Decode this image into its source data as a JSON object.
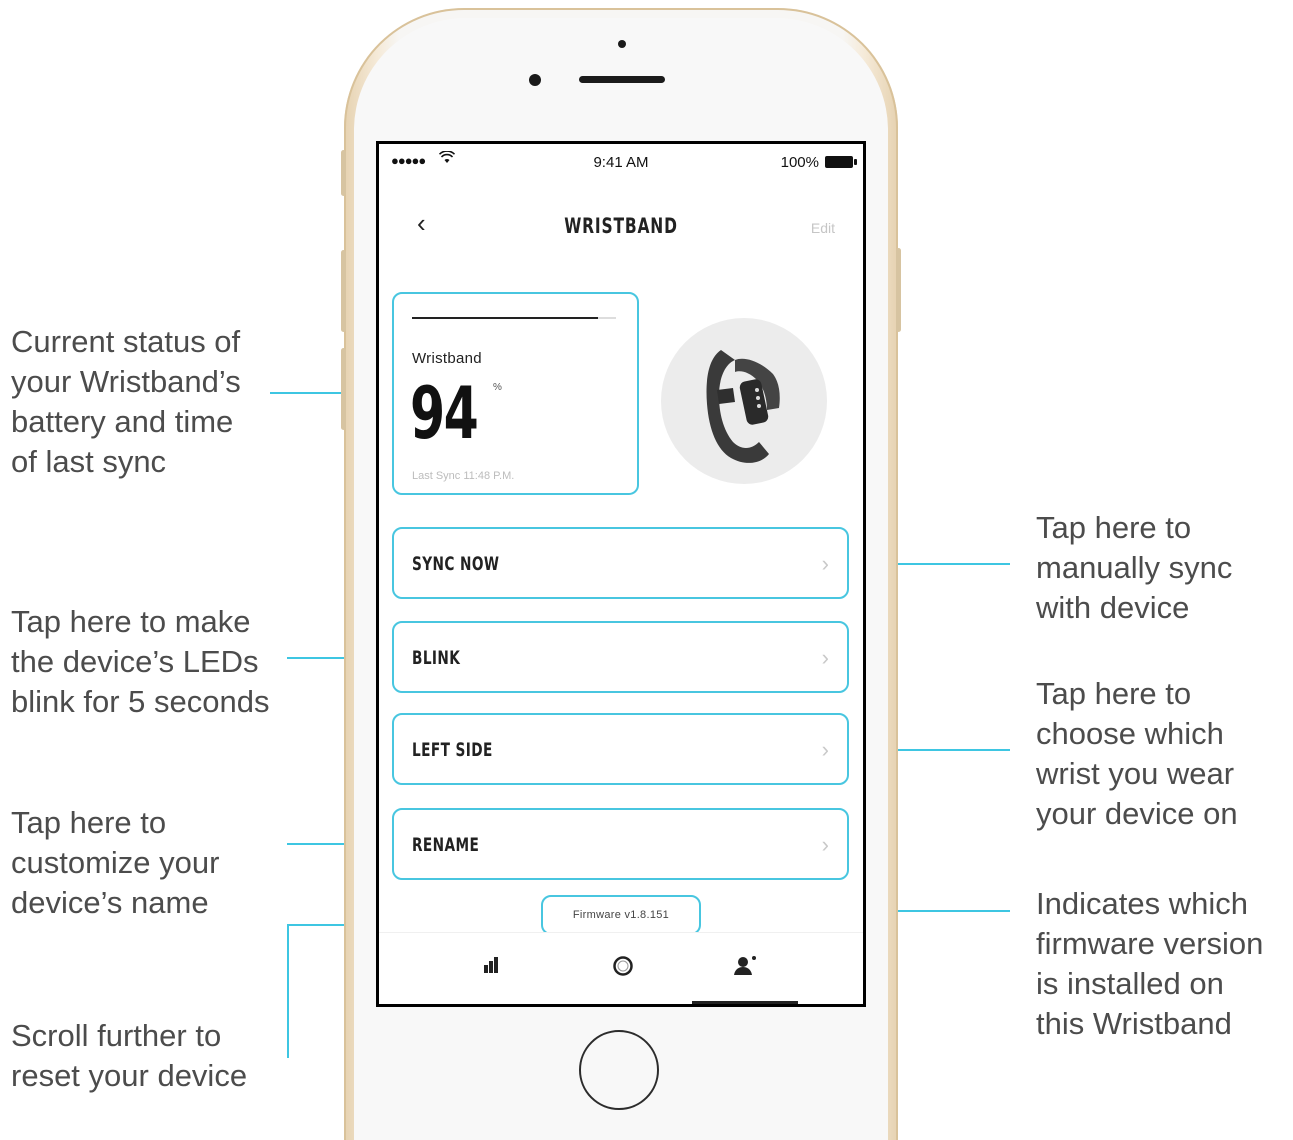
{
  "annotations": {
    "battery_status": "Current status of\nyour Wristband’s\nbattery and time\nof last sync",
    "blink": "Tap here to make\nthe device’s LEDs\nblink for 5 seconds",
    "rename": "Tap here to\ncustomize your\ndevice’s name",
    "scroll": "Scroll further to\nreset your device",
    "sync": "Tap here to\nmanually sync\nwith device",
    "side": "Tap here to\nchoose which\nwrist you wear\nyour device on",
    "firmware": "Indicates which\nfirmware version\nis installed on\nthis Wristband"
  },
  "status_bar": {
    "signal": "●●●●●",
    "time": "9:41 AM",
    "battery_percent": "100%"
  },
  "nav": {
    "back_symbol": "‹",
    "title": "WRISTBAND",
    "edit_label": "Edit"
  },
  "battery_card": {
    "label": "Wristband",
    "value": "94",
    "unit": "%",
    "last_sync": "Last Sync 11:48 P.M.",
    "level_fraction": 0.94
  },
  "rows": [
    {
      "label": "SYNC NOW"
    },
    {
      "label": "BLINK"
    },
    {
      "label": "LEFT SIDE"
    },
    {
      "label": "RENAME"
    }
  ],
  "firmware": "Firmware v1.8.151",
  "tabs": {
    "active": "profile",
    "icons": [
      "stats-icon",
      "ring-icon",
      "profile-icon"
    ]
  },
  "colors": {
    "accent": "#48c6e0",
    "annotation_line": "#3ec6e2",
    "phone_gold": "#e6d2b1"
  }
}
